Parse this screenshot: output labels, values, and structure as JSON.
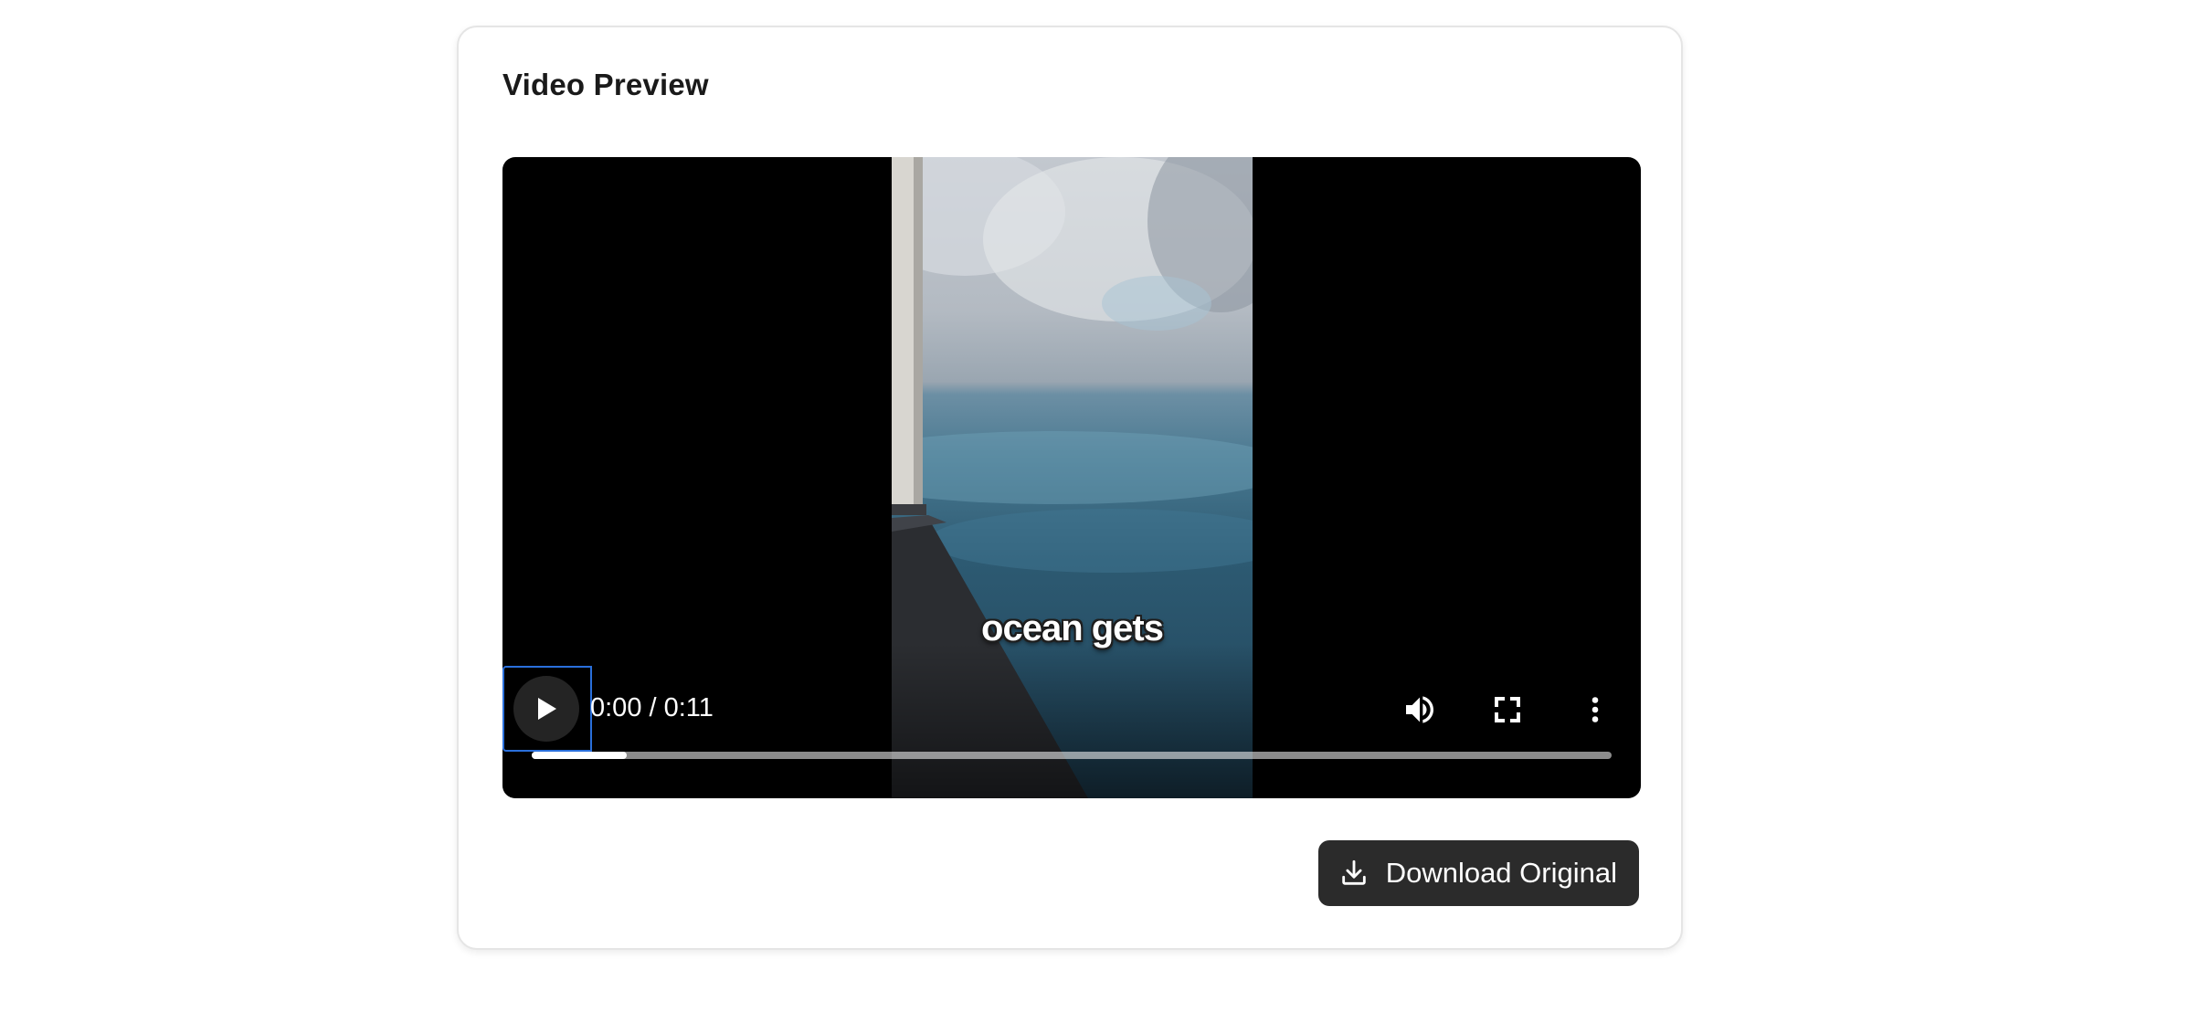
{
  "card": {
    "title": "Video Preview"
  },
  "player": {
    "caption": "ocean gets",
    "time_display": "0:00 / 0:11",
    "progress_fraction": 0.088,
    "icons": {
      "play": "play-icon",
      "volume": "volume-icon",
      "fullscreen": "fullscreen-icon",
      "more": "more-options-icon"
    }
  },
  "actions": {
    "download_label": "Download Original",
    "download_icon": "download-icon"
  }
}
